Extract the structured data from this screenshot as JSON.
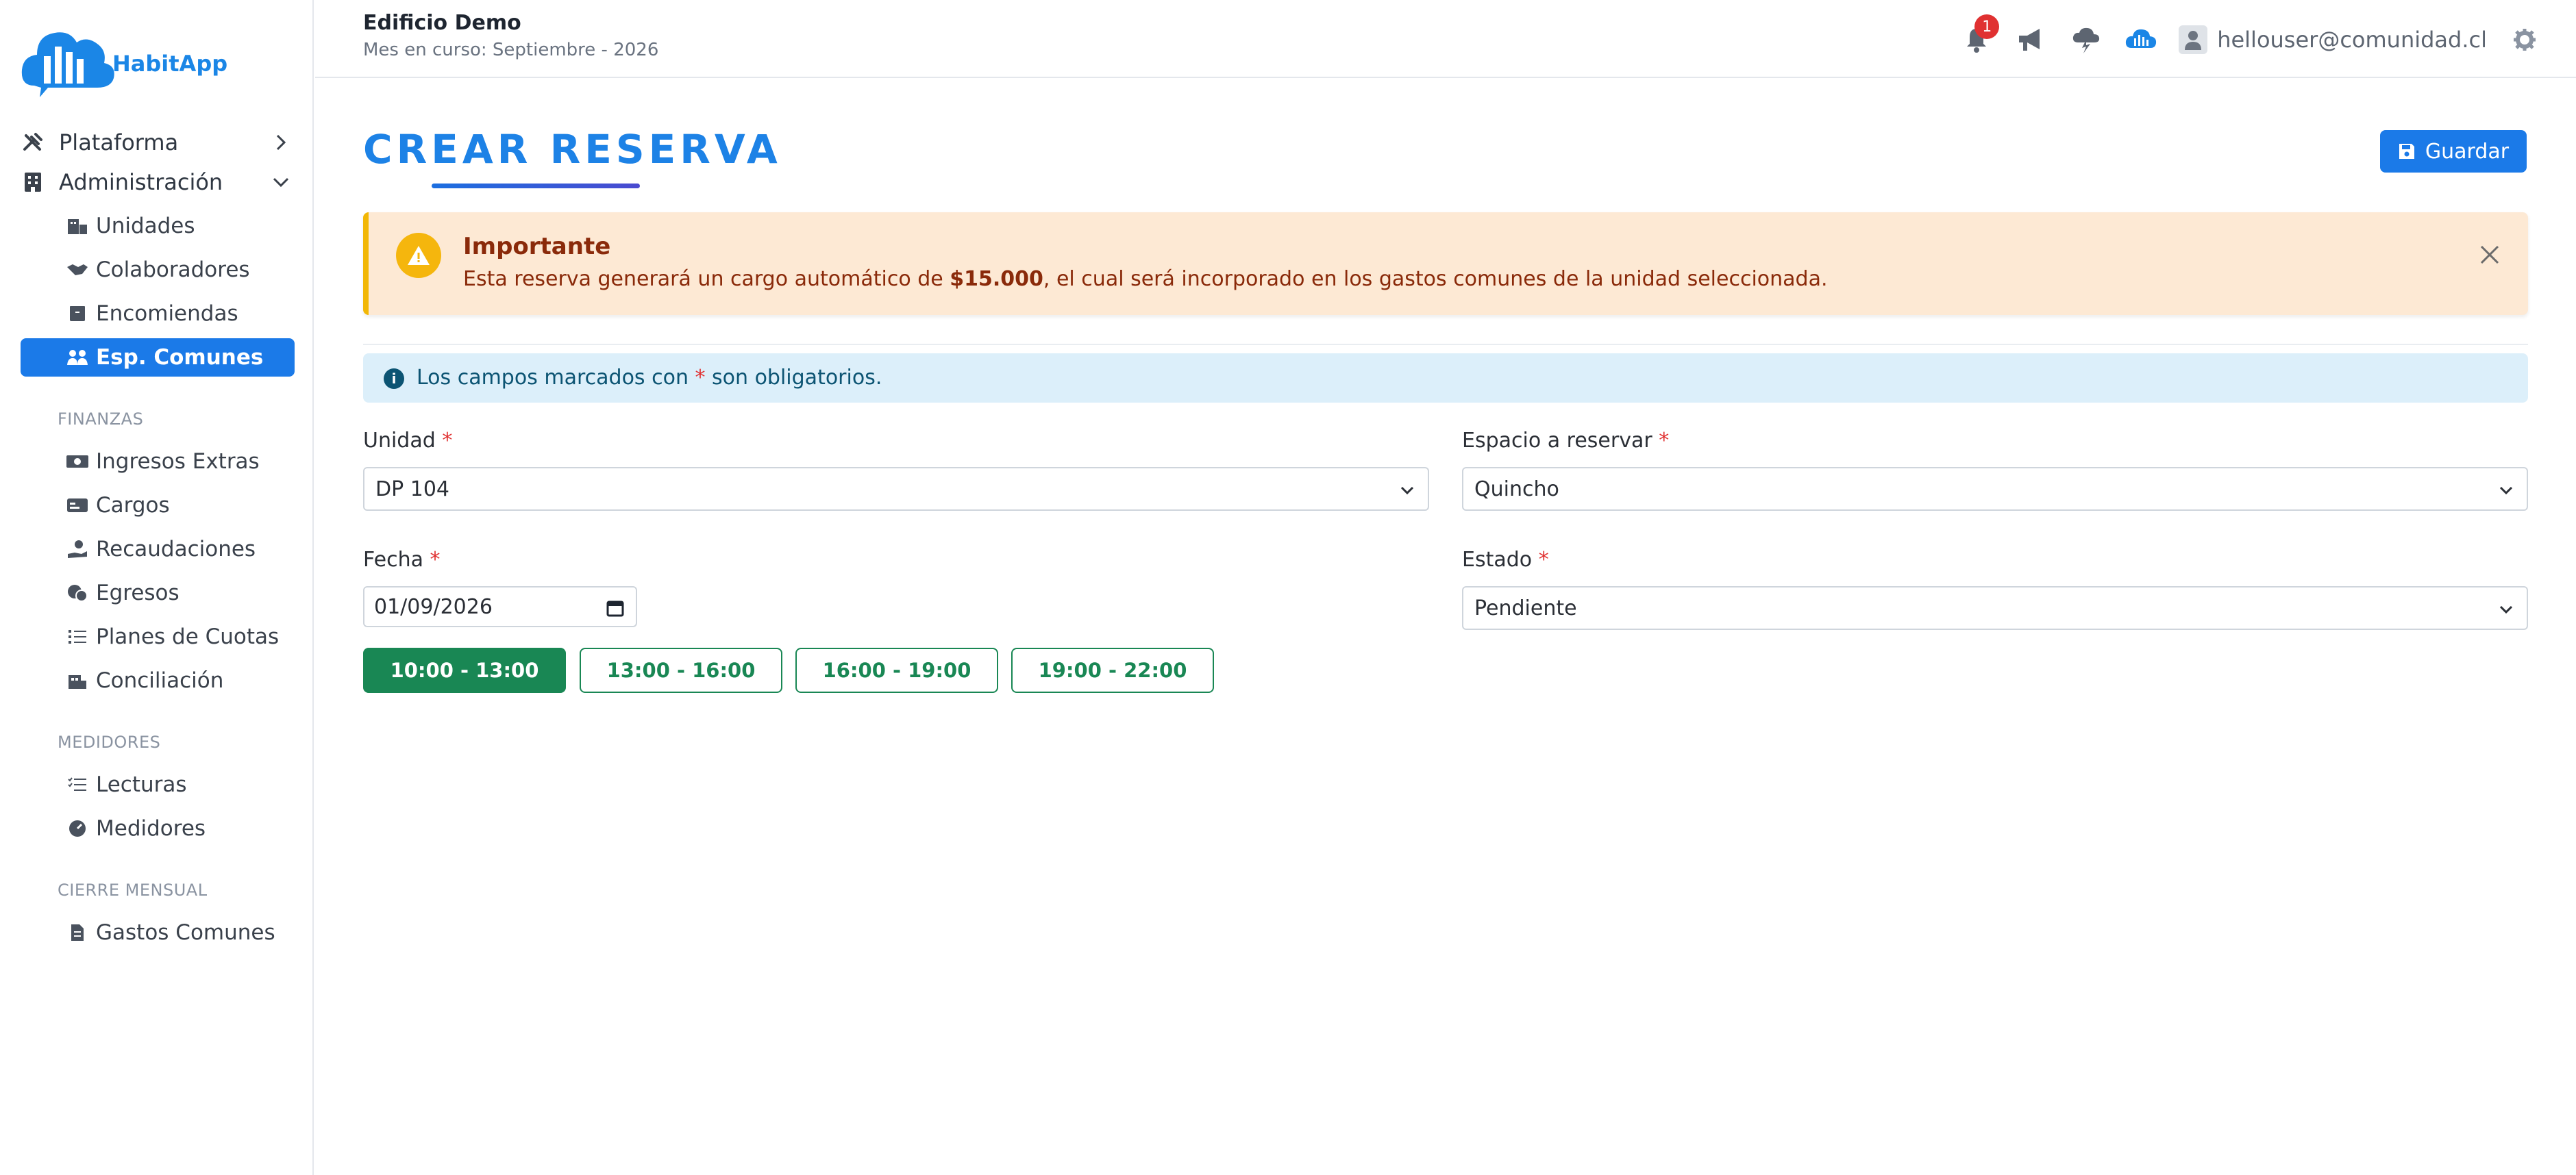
{
  "app": {
    "logo_text": "HabitApp"
  },
  "header": {
    "building": "Edificio Demo",
    "period": "Mes en curso: Septiembre - 2026",
    "notification_count": "1",
    "user_email": "hellouser@comunidad.cl"
  },
  "sidebar": {
    "top": [
      {
        "label": "Plataforma",
        "icon": "tools-icon"
      },
      {
        "label": "Administración",
        "icon": "building-icon"
      }
    ],
    "admin_items": [
      {
        "label": "Unidades",
        "icon": "units-icon"
      },
      {
        "label": "Colaboradores",
        "icon": "handshake-icon"
      },
      {
        "label": "Encomiendas",
        "icon": "package-icon"
      },
      {
        "label": "Esp. Comunes",
        "icon": "people-icon",
        "active": true
      }
    ],
    "sections": {
      "finanzas": "FINANZAS",
      "medidores": "MEDIDORES",
      "cierre": "CIERRE MENSUAL"
    },
    "finanzas_items": [
      {
        "label": "Ingresos Extras",
        "icon": "cash-icon"
      },
      {
        "label": "Cargos",
        "icon": "card-icon"
      },
      {
        "label": "Recaudaciones",
        "icon": "hand-coin-icon"
      },
      {
        "label": "Egresos",
        "icon": "money-out-icon"
      },
      {
        "label": "Planes de Cuotas",
        "icon": "list-icon"
      },
      {
        "label": "Conciliación",
        "icon": "bank-icon"
      }
    ],
    "medidores_items": [
      {
        "label": "Lecturas",
        "icon": "checklist-icon"
      },
      {
        "label": "Medidores",
        "icon": "gauge-icon"
      }
    ],
    "cierre_items": [
      {
        "label": "Gastos Comunes",
        "icon": "invoice-icon"
      }
    ]
  },
  "main": {
    "title": "CREAR RESERVA",
    "save_label": "Guardar",
    "warning": {
      "title": "Importante",
      "text_before": "Esta reserva generará un cargo automático de ",
      "amount": "$15.000",
      "text_after": ", el cual será incorporado en los gastos comunes de la unidad seleccionada."
    },
    "info": {
      "before": "Los campos marcados con ",
      "star": "*",
      "after": " son obligatorios."
    },
    "fields": {
      "unidad_label": "Unidad",
      "unidad_value": "DP 104",
      "espacio_label": "Espacio a reservar",
      "espacio_value": "Quincho",
      "fecha_label": "Fecha",
      "fecha_value": "01/09/2026",
      "estado_label": "Estado",
      "estado_value": "Pendiente",
      "required_mark": "*"
    },
    "slots": [
      "10:00 - 13:00",
      "13:00 - 16:00",
      "16:00 - 19:00",
      "19:00 - 22:00"
    ],
    "selected_slot": "10:00 - 13:00"
  },
  "colors": {
    "accent": "#1b7ae8",
    "success": "#198754",
    "warning_bg": "#fde9d4",
    "info_bg": "#dceffa"
  }
}
